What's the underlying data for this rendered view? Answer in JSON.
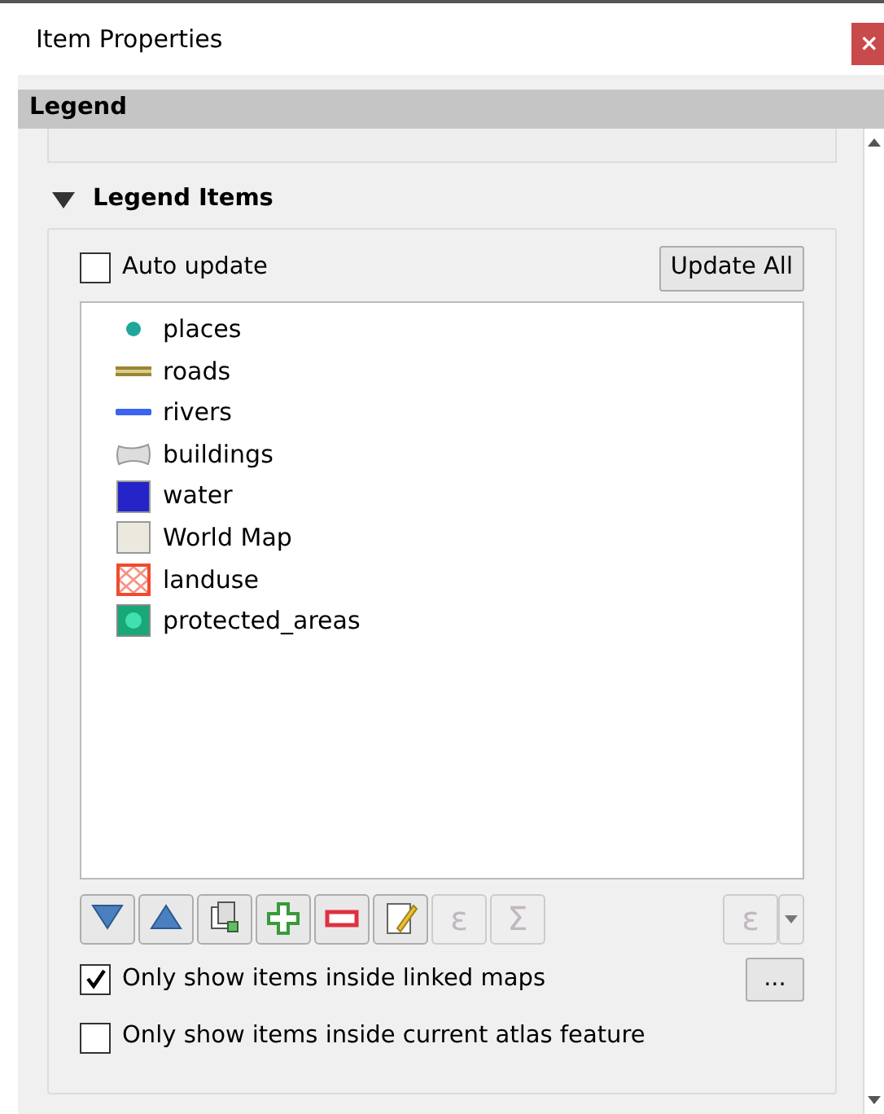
{
  "window": {
    "title": "Item Properties",
    "close": "×"
  },
  "panel": {
    "title": "Legend"
  },
  "section": {
    "title": "Legend Items",
    "expanded": true
  },
  "auto_update": {
    "label": "Auto update",
    "checked": false
  },
  "update_all": {
    "label": "Update All"
  },
  "legend_items": [
    {
      "label": "places",
      "kind": "dot",
      "color": "#1fa89a"
    },
    {
      "label": "roads",
      "kind": "line",
      "color": "#9c8431"
    },
    {
      "label": "rivers",
      "kind": "thin-line",
      "color": "#3b64f0"
    },
    {
      "label": "buildings",
      "kind": "blob",
      "color": "#dddddd"
    },
    {
      "label": "water",
      "kind": "fill",
      "color": "#2424c8"
    },
    {
      "label": "World Map",
      "kind": "fill",
      "color": "#ebe8de"
    },
    {
      "label": "landuse",
      "kind": "hatch",
      "color": "#f04a30"
    },
    {
      "label": "protected_areas",
      "kind": "pattern",
      "color": "#18a878"
    }
  ],
  "toolbar": [
    {
      "kind": "move-down",
      "disabled": false
    },
    {
      "kind": "move-up",
      "disabled": false
    },
    {
      "kind": "add-group",
      "disabled": false
    },
    {
      "kind": "add",
      "disabled": false
    },
    {
      "kind": "remove",
      "disabled": false
    },
    {
      "kind": "edit",
      "disabled": false
    },
    {
      "kind": "text",
      "label": "ε",
      "disabled": true
    },
    {
      "kind": "text",
      "label": "Σ",
      "disabled": true
    }
  ],
  "expression_button": {
    "label": "ε",
    "disabled": true
  },
  "options": [
    {
      "label": "Only show items inside linked maps",
      "checked": true,
      "button": "..."
    },
    {
      "label": "Only show items inside current atlas feature",
      "checked": false
    }
  ]
}
